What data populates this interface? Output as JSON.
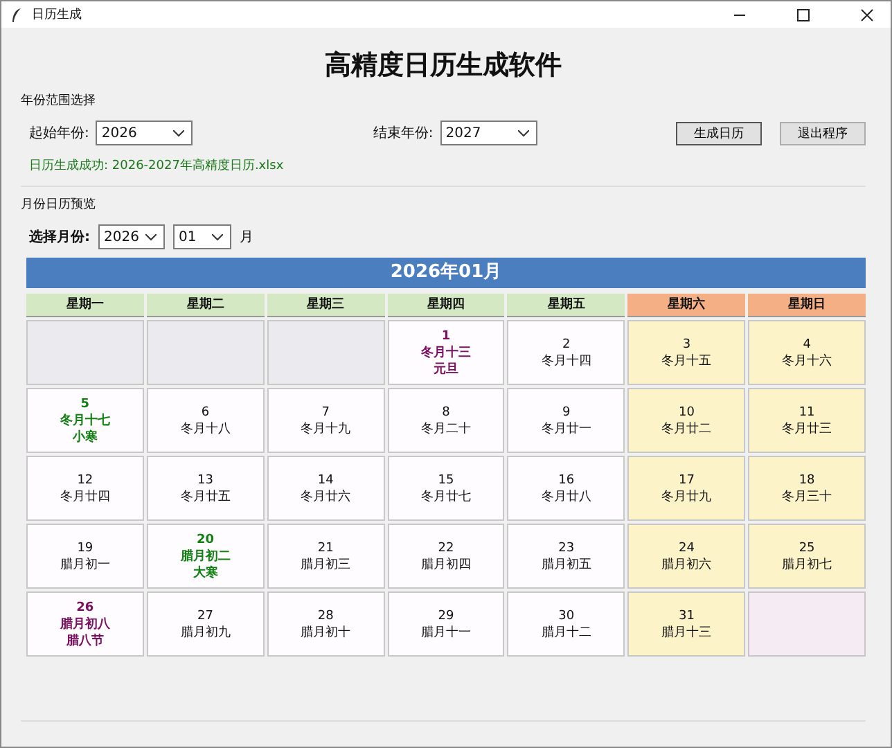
{
  "window": {
    "title": "日历生成"
  },
  "heading": "高精度日历生成软件",
  "range": {
    "legend": "年份范围选择",
    "start_label": "起始年份:",
    "start_value": "2026",
    "end_label": "结束年份:",
    "end_value": "2027",
    "buttons": [
      "生成日历",
      "退出程序"
    ],
    "message": "日历生成成功: 2026-2027年高精度日历.xlsx"
  },
  "preview": {
    "legend": "月份日历预览",
    "select_label": "选择月份:",
    "year_value": "2026",
    "month_value": "01",
    "month_suffix": "月",
    "banner": "2026年01月",
    "weekdays": [
      {
        "label": "星期一",
        "weekend": false
      },
      {
        "label": "星期二",
        "weekend": false
      },
      {
        "label": "星期三",
        "weekend": false
      },
      {
        "label": "星期四",
        "weekend": false
      },
      {
        "label": "星期五",
        "weekend": false
      },
      {
        "label": "星期六",
        "weekend": true
      },
      {
        "label": "星期日",
        "weekend": true
      }
    ],
    "cells": [
      {
        "kind": "blank"
      },
      {
        "kind": "blank"
      },
      {
        "kind": "blank"
      },
      {
        "kind": "holiday",
        "day": "1",
        "lunar": "冬月十三",
        "festival": "元旦",
        "weekend": false
      },
      {
        "kind": "normal",
        "day": "2",
        "lunar": "冬月十四",
        "weekend": false
      },
      {
        "kind": "normal",
        "day": "3",
        "lunar": "冬月十五",
        "weekend": true
      },
      {
        "kind": "normal",
        "day": "4",
        "lunar": "冬月十六",
        "weekend": true
      },
      {
        "kind": "term",
        "day": "5",
        "lunar": "冬月十七",
        "festival": "小寒",
        "weekend": false
      },
      {
        "kind": "normal",
        "day": "6",
        "lunar": "冬月十八",
        "weekend": false
      },
      {
        "kind": "normal",
        "day": "7",
        "lunar": "冬月十九",
        "weekend": false
      },
      {
        "kind": "normal",
        "day": "8",
        "lunar": "冬月二十",
        "weekend": false
      },
      {
        "kind": "normal",
        "day": "9",
        "lunar": "冬月廿一",
        "weekend": false
      },
      {
        "kind": "normal",
        "day": "10",
        "lunar": "冬月廿二",
        "weekend": true
      },
      {
        "kind": "normal",
        "day": "11",
        "lunar": "冬月廿三",
        "weekend": true
      },
      {
        "kind": "normal",
        "day": "12",
        "lunar": "冬月廿四",
        "weekend": false
      },
      {
        "kind": "normal",
        "day": "13",
        "lunar": "冬月廿五",
        "weekend": false
      },
      {
        "kind": "normal",
        "day": "14",
        "lunar": "冬月廿六",
        "weekend": false
      },
      {
        "kind": "normal",
        "day": "15",
        "lunar": "冬月廿七",
        "weekend": false
      },
      {
        "kind": "normal",
        "day": "16",
        "lunar": "冬月廿八",
        "weekend": false
      },
      {
        "kind": "normal",
        "day": "17",
        "lunar": "冬月廿九",
        "weekend": true
      },
      {
        "kind": "normal",
        "day": "18",
        "lunar": "冬月三十",
        "weekend": true
      },
      {
        "kind": "normal",
        "day": "19",
        "lunar": "腊月初一",
        "weekend": false
      },
      {
        "kind": "term",
        "day": "20",
        "lunar": "腊月初二",
        "festival": "大寒",
        "weekend": false
      },
      {
        "kind": "normal",
        "day": "21",
        "lunar": "腊月初三",
        "weekend": false
      },
      {
        "kind": "normal",
        "day": "22",
        "lunar": "腊月初四",
        "weekend": false
      },
      {
        "kind": "normal",
        "day": "23",
        "lunar": "腊月初五",
        "weekend": false
      },
      {
        "kind": "normal",
        "day": "24",
        "lunar": "腊月初六",
        "weekend": true
      },
      {
        "kind": "normal",
        "day": "25",
        "lunar": "腊月初七",
        "weekend": true
      },
      {
        "kind": "holiday",
        "day": "26",
        "lunar": "腊月初八",
        "festival": "腊八节",
        "weekend": false
      },
      {
        "kind": "normal",
        "day": "27",
        "lunar": "腊月初九",
        "weekend": false
      },
      {
        "kind": "normal",
        "day": "28",
        "lunar": "腊月初十",
        "weekend": false
      },
      {
        "kind": "normal",
        "day": "29",
        "lunar": "腊月十一",
        "weekend": false
      },
      {
        "kind": "normal",
        "day": "30",
        "lunar": "腊月十二",
        "weekend": false
      },
      {
        "kind": "normal",
        "day": "31",
        "lunar": "腊月十三",
        "weekend": true
      },
      {
        "kind": "blank"
      }
    ]
  }
}
